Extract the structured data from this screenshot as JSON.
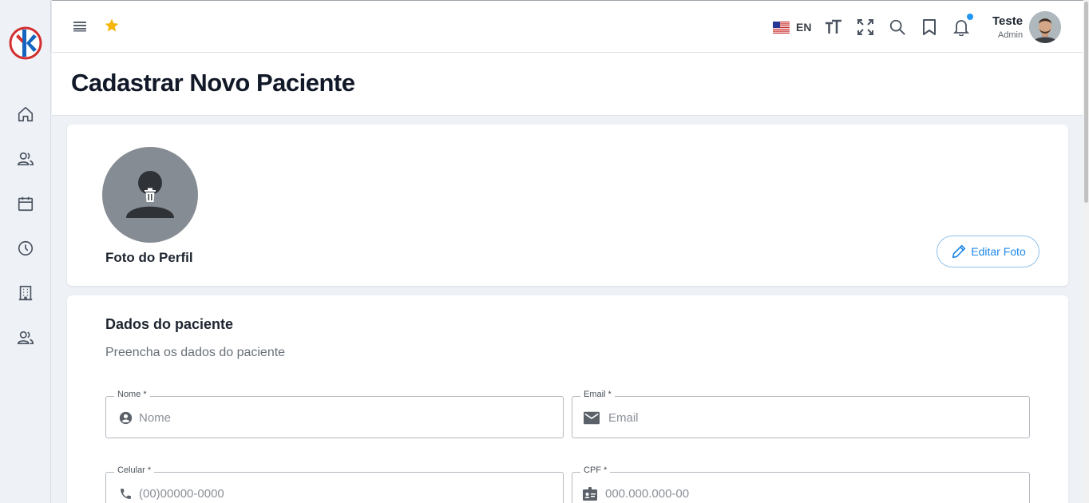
{
  "sidebar": {
    "items": [
      {
        "icon": "home-icon"
      },
      {
        "icon": "users-icon"
      },
      {
        "icon": "calendar-icon"
      },
      {
        "icon": "clock-icon"
      },
      {
        "icon": "building-icon"
      },
      {
        "icon": "group-icon"
      }
    ]
  },
  "header": {
    "language_code": "EN",
    "user_name": "Teste",
    "user_role": "Admin",
    "notification_dot_color": "#2196f3"
  },
  "page": {
    "title": "Cadastrar Novo Paciente"
  },
  "photo_card": {
    "label": "Foto do Perfil",
    "edit_button": "Editar Foto"
  },
  "form_card": {
    "title": "Dados do paciente",
    "subtitle": "Preencha os dados do paciente",
    "fields": {
      "name": {
        "label": "Nome *",
        "placeholder": "Nome",
        "value": ""
      },
      "email": {
        "label": "Email *",
        "placeholder": "Email",
        "value": ""
      },
      "phone": {
        "label": "Celular *",
        "placeholder": "(00)00000-0000",
        "value": ""
      },
      "cpf": {
        "label": "CPF *",
        "placeholder": "000.000.000-00",
        "value": ""
      }
    }
  },
  "colors": {
    "accent": "#1e88e5",
    "logo_red": "#d32f2f",
    "logo_blue": "#1565c0",
    "star": "#f5b50a"
  }
}
